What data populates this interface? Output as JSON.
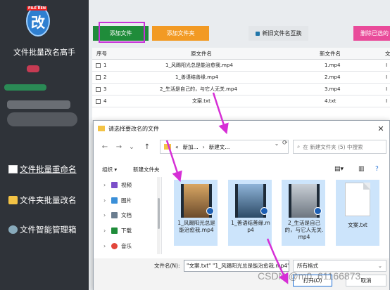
{
  "app": {
    "title": "文件批量改名高手",
    "logo_tag": "FILE REN",
    "logo_char": "改"
  },
  "sidebar": {
    "items": [
      {
        "label": "文件批量重命名",
        "icon": "document-icon",
        "active": true
      },
      {
        "label": "文件夹批量改名",
        "icon": "folder-icon",
        "active": false
      },
      {
        "label": "文件智能管理箱",
        "icon": "gear-icon",
        "active": false
      }
    ]
  },
  "toolbar": {
    "add_file": "添加文件",
    "add_folder": "添加文件夹",
    "swap_names": "新旧文件名互换",
    "delete_selected": "删除已选的"
  },
  "table": {
    "headers": [
      "序号",
      "原文件名",
      "新文件名",
      "文"
    ],
    "rows": [
      {
        "no": "1",
        "old": "1_风踢阳光总是能治愈我.mp4",
        "new": "1.mp4",
        "ext": "I"
      },
      {
        "no": "2",
        "old": "1_善语结善缘.mp4",
        "new": "2.mp4",
        "ext": "I"
      },
      {
        "no": "3",
        "old": "2_生活是自己的，与它人无关.mp4",
        "new": "3.mp4",
        "ext": "I"
      },
      {
        "no": "4",
        "old": "文案.txt",
        "new": "4.txt",
        "ext": "I"
      }
    ]
  },
  "dialog": {
    "title": "请选择要改名的文件",
    "path_prefix": "«",
    "path_1": "新加...",
    "path_sep": "›",
    "path_2": "新建文...",
    "search_placeholder": "在 新建文件夹 (5) 中搜索",
    "organize": "组织 ▾",
    "new_folder": "新建文件夹",
    "tree": [
      {
        "label": "视频",
        "color": "#7b4fc9"
      },
      {
        "label": "图片",
        "color": "#3a8fd8"
      },
      {
        "label": "文档",
        "color": "#6a7d8f"
      },
      {
        "label": "下载",
        "color": "#1f8c3a"
      },
      {
        "label": "音乐",
        "color": "#e2463a"
      }
    ],
    "files": [
      {
        "name": "1_风踢阳光总是能治愈我.mp4"
      },
      {
        "name": "1_善语结善缘.mp4"
      },
      {
        "name": "2_生活是自己的，与它人无关.mp4"
      },
      {
        "name": "文案.txt"
      }
    ],
    "filename_label": "文件名(N):",
    "filename_value": "\"文案.txt\" \"1_风踢阳光总是能治愈我.mp4\"",
    "filter": "所有格式",
    "open": "打开(O)",
    "cancel": "取消"
  },
  "watermark": "CSDN @m0_61166873",
  "colors": {
    "sidebar_bg": "#2f3339",
    "add_file": "#1f8c3a",
    "add_folder": "#f29a24",
    "delete": "#e94b9a",
    "highlight": "#c832d9",
    "selection": "#cce4fb"
  }
}
